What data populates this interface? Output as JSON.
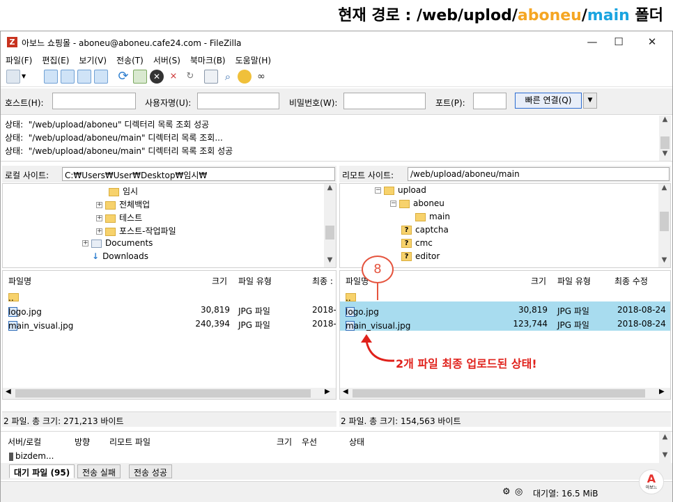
{
  "annotation": {
    "prefix": "현재 경로 : /web/uplod/",
    "part_orange": "aboneu",
    "slash": "/",
    "part_blue": "main",
    "suffix": " 폴더",
    "callout_number": "8",
    "callout_text": "2개 파일 최종 업로드된 상태!"
  },
  "window": {
    "title": "아보느 쇼핑몰 - aboneu@aboneu.cafe24.com - FileZilla",
    "min": "—",
    "max": "☐",
    "close": "✕"
  },
  "menu": [
    "파일(F)",
    "편집(E)",
    "보기(V)",
    "전송(T)",
    "서버(S)",
    "북마크(B)",
    "도움말(H)"
  ],
  "quickconnect": {
    "host_label": "호스트(H):",
    "user_label": "사용자명(U):",
    "pass_label": "비밀번호(W):",
    "port_label": "포트(P):",
    "host": "",
    "user": "",
    "pass": "",
    "port": "",
    "button": "빠른 연결(Q)",
    "dropdown": "▼"
  },
  "log": [
    {
      "label": "상태:",
      "text": "\"/web/upload/aboneu\" 디렉터리 목록 조회 성공"
    },
    {
      "label": "상태:",
      "text": "\"/web/upload/aboneu/main\" 디렉터리 목록 조회..."
    },
    {
      "label": "상태:",
      "text": "\"/web/upload/aboneu/main\" 디렉터리 목록 조회 성공"
    }
  ],
  "local": {
    "label": "로컬 사이트:",
    "path": "C:₩Users₩User₩Desktop₩임시₩",
    "tree": [
      {
        "name": "임시",
        "expander": ""
      },
      {
        "name": "전체백업",
        "expander": "+"
      },
      {
        "name": "테스트",
        "expander": "+"
      },
      {
        "name": "포스트-작업파일",
        "expander": "+"
      },
      {
        "name": "Documents",
        "expander": "+"
      },
      {
        "name": "Downloads",
        "expander": ""
      }
    ],
    "columns": {
      "name": "파일명",
      "size": "크기",
      "type": "파일 유형",
      "modified": "최종 :"
    },
    "files": [
      {
        "name": "..",
        "size": "",
        "type": "",
        "modified": ""
      },
      {
        "name": "logo.jpg",
        "size": "30,819",
        "type": "JPG 파일",
        "modified": "2018-"
      },
      {
        "name": "main_visual.jpg",
        "size": "240,394",
        "type": "JPG 파일",
        "modified": "2018-"
      }
    ],
    "status": "2 파일. 총 크기: 271,213 바이트"
  },
  "remote": {
    "label": "리모트 사이트:",
    "path": "/web/upload/aboneu/main",
    "tree": [
      {
        "name": "upload",
        "expander": "−",
        "kind": "folder"
      },
      {
        "name": "aboneu",
        "expander": "−",
        "kind": "folder"
      },
      {
        "name": "main",
        "expander": "",
        "kind": "folder"
      },
      {
        "name": "captcha",
        "expander": "",
        "kind": "unknown"
      },
      {
        "name": "cmc",
        "expander": "",
        "kind": "unknown"
      },
      {
        "name": "editor",
        "expander": "",
        "kind": "unknown"
      }
    ],
    "columns": {
      "name": "파일명",
      "size": "크기",
      "type": "파일 유형",
      "modified": "최종 수정"
    },
    "files": [
      {
        "name": "..",
        "size": "",
        "type": "",
        "modified": ""
      },
      {
        "name": "logo.jpg",
        "size": "30,819",
        "type": "JPG 파일",
        "modified": "2018-08-24"
      },
      {
        "name": "main_visual.jpg",
        "size": "123,744",
        "type": "JPG 파일",
        "modified": "2018-08-24"
      }
    ],
    "status": "2 파일. 총 크기: 154,563 바이트"
  },
  "queue": {
    "columns": {
      "server": "서버/로컬",
      "direction": "방향",
      "remote": "리모트 파일",
      "size": "크기",
      "priority": "우선",
      "status": "상태"
    },
    "row": "bizdem...",
    "tabs": [
      "대기 파일 (95)",
      "전송 실패",
      "전송 성공"
    ],
    "queue_size": "대기열: 16.5 MiB",
    "logo_text": "아보느"
  },
  "colors": {
    "orange": "#f5a623",
    "blue": "#1aa4e0",
    "selection": "#a8dcef",
    "callout": "#e5533d"
  }
}
